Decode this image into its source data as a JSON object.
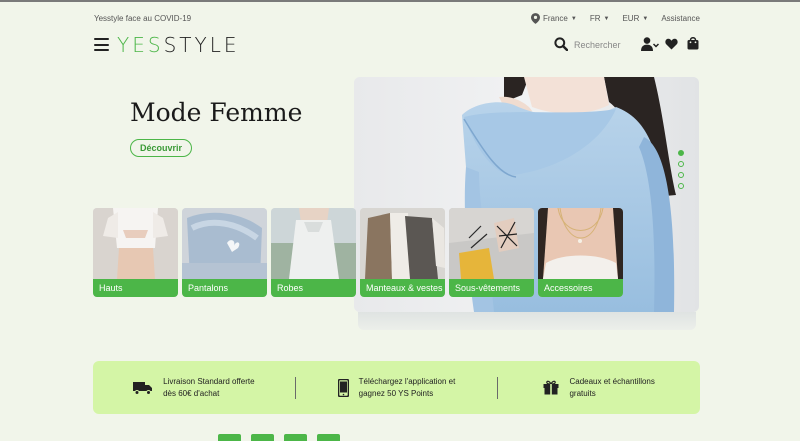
{
  "topbar": {
    "covid_link": "Yesstyle face au COVID-19",
    "country": "France",
    "language": "FR",
    "currency": "EUR",
    "help": "Assistance"
  },
  "header": {
    "logo_yes": "YES",
    "logo_style": "STYLE",
    "search_placeholder": "Rechercher"
  },
  "hero": {
    "title": "Mode Femme",
    "cta": "Découvrir",
    "slides": 4,
    "active_slide": 1
  },
  "categories": [
    {
      "label": "Hauts"
    },
    {
      "label": "Pantalons"
    },
    {
      "label": "Robes"
    },
    {
      "label": "Manteaux & vestes"
    },
    {
      "label": "Sous-vêtements"
    },
    {
      "label": "Accessoires"
    }
  ],
  "perks": [
    {
      "icon": "truck-icon",
      "line1": "Livraison Standard offerte",
      "line2": "dès 60€ d'achat"
    },
    {
      "icon": "mobile-icon",
      "line1": "Téléchargez l'application et",
      "line2": "gagnez 50 YS Points"
    },
    {
      "icon": "gift-icon",
      "line1": "Cadeaux et échantillons",
      "line2": "gratuits"
    }
  ],
  "colors": {
    "brand_green": "#4cb648",
    "page_bg": "#f1f5ea",
    "perks_bg": "#d4f5a6"
  }
}
